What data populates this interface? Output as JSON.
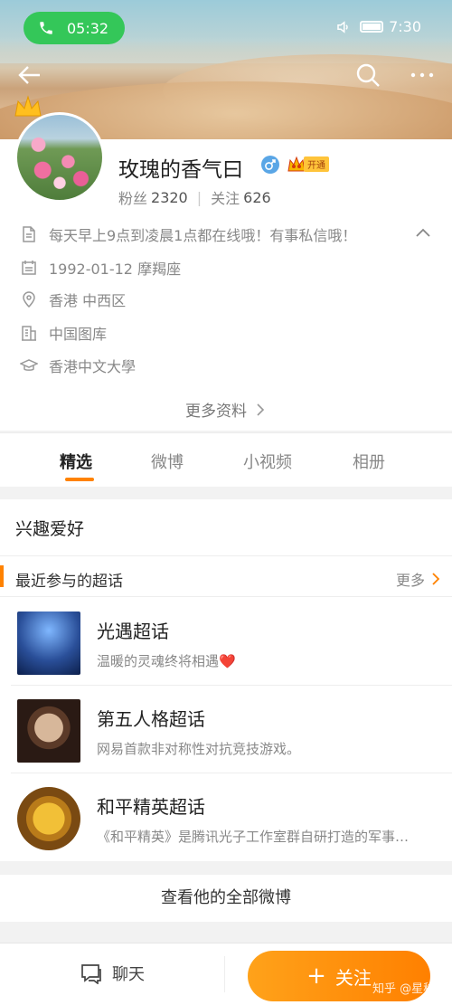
{
  "status_bar": {
    "call_time": "05:32",
    "clock": "7:30"
  },
  "profile": {
    "name": "玫瑰的香气曰",
    "vip_label": "开通",
    "followers_label": "粉丝",
    "followers_count": "2320",
    "following_label": "关注",
    "following_count": "626",
    "bio": "每天早上9点到凌晨1点都在线哦！有事私信哦！",
    "birthday": "1992-01-12 摩羯座",
    "location": "香港 中西区",
    "company": "中国图库",
    "school": "香港中文大學",
    "more_info": "更多资料"
  },
  "tabs": [
    "精选",
    "微博",
    "小视频",
    "相册"
  ],
  "active_tab": 0,
  "interests": {
    "title": "兴趣爱好",
    "topics_header": "最近参与的超话",
    "more": "更多",
    "topics": [
      {
        "title": "光遇超话",
        "desc": "温暖的灵魂终将相遇❤️"
      },
      {
        "title": "第五人格超话",
        "desc": "网易首款非对称性对抗竞技游戏。"
      },
      {
        "title": "和平精英超话",
        "desc": "《和平精英》是腾讯光子工作室群自研打造的军事…"
      }
    ]
  },
  "all_weibo": "查看他的全部微博",
  "bottom": {
    "chat": "聊天",
    "follow": "关注"
  },
  "watermark": "知乎 @星移",
  "colors": {
    "accent": "#ff8200",
    "call_green": "#34c759"
  }
}
